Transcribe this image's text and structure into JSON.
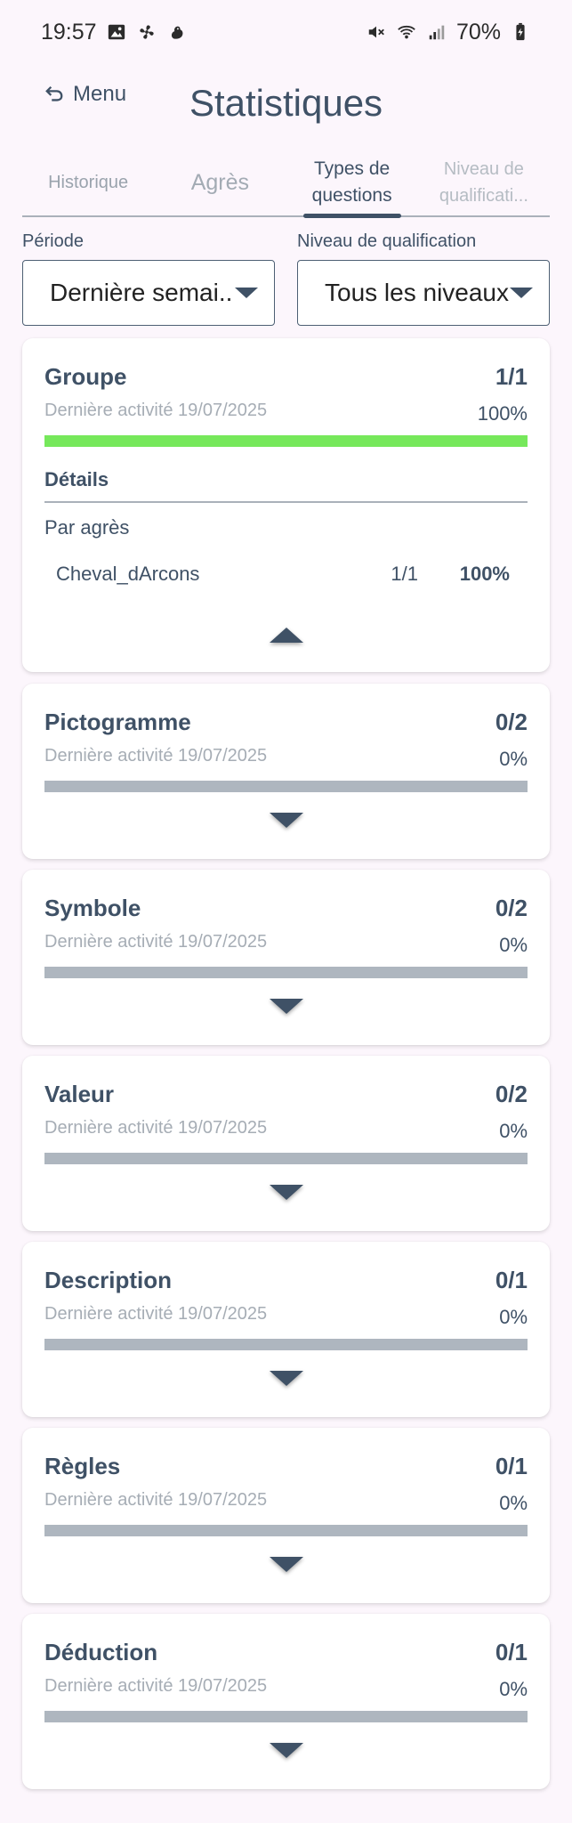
{
  "status_bar": {
    "time": "19:57",
    "battery": "70%",
    "left_icons": [
      "image-icon",
      "fan-icon",
      "bird-icon"
    ],
    "right_icons": [
      "mute-icon",
      "wifi-icon",
      "signal-icon",
      "battery-icon"
    ]
  },
  "header": {
    "back_label": "Menu",
    "title": "Statistiques"
  },
  "tabs": [
    {
      "label": "Historique",
      "active": false
    },
    {
      "label": "Agrès",
      "active": false
    },
    {
      "label": "Types de\nquestions",
      "active": true
    },
    {
      "label": "Niveau de\nqualificati...",
      "active": false
    }
  ],
  "filters": {
    "period": {
      "label": "Période",
      "value": "Dernière semai.."
    },
    "level": {
      "label": "Niveau de qualification",
      "value": "Tous les niveaux"
    }
  },
  "colors": {
    "accent": "#3f5166",
    "progress_fill": "#76e85b",
    "progress_track": "#aeb6bf",
    "background": "#fcf6fc"
  },
  "cards": [
    {
      "title": "Groupe",
      "count": "1/1",
      "last_activity": "Dernière activité 19/07/2025",
      "percent": "100%",
      "progress": 1.0,
      "expanded": true,
      "details_title": "Détails",
      "details_sub": "Par agrès",
      "details": [
        {
          "name": "Cheval_dArcons",
          "count": "1/1",
          "percent": "100%"
        }
      ]
    },
    {
      "title": "Pictogramme",
      "count": "0/2",
      "last_activity": "Dernière activité 19/07/2025",
      "percent": "0%",
      "progress": 0,
      "expanded": false
    },
    {
      "title": "Symbole",
      "count": "0/2",
      "last_activity": "Dernière activité 19/07/2025",
      "percent": "0%",
      "progress": 0,
      "expanded": false
    },
    {
      "title": "Valeur",
      "count": "0/2",
      "last_activity": "Dernière activité 19/07/2025",
      "percent": "0%",
      "progress": 0,
      "expanded": false
    },
    {
      "title": "Description",
      "count": "0/1",
      "last_activity": "Dernière activité 19/07/2025",
      "percent": "0%",
      "progress": 0,
      "expanded": false
    },
    {
      "title": "Règles",
      "count": "0/1",
      "last_activity": "Dernière activité 19/07/2025",
      "percent": "0%",
      "progress": 0,
      "expanded": false
    },
    {
      "title": "Déduction",
      "count": "0/1",
      "last_activity": "Dernière activité 19/07/2025",
      "percent": "0%",
      "progress": 0,
      "expanded": false
    }
  ]
}
